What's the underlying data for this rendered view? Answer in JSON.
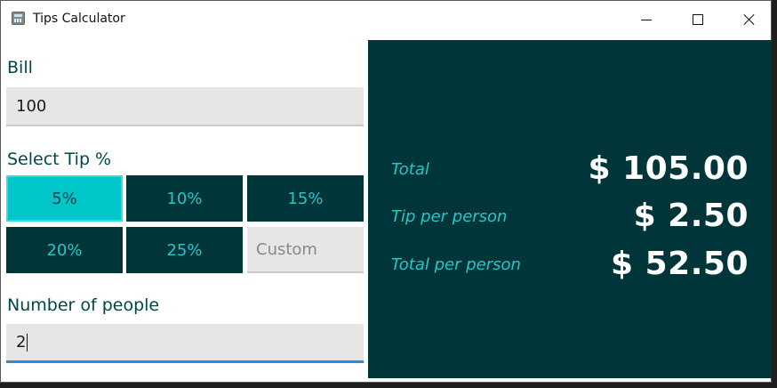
{
  "window": {
    "title": "Tips Calculator",
    "controls": [
      "minimize",
      "maximize",
      "close"
    ]
  },
  "bill": {
    "label": "Bill",
    "value": "100"
  },
  "tip": {
    "label": "Select Tip %",
    "options": [
      "5%",
      "10%",
      "15%",
      "20%",
      "25%"
    ],
    "selected": "5%",
    "custom_placeholder": "Custom"
  },
  "people": {
    "label": "Number of people",
    "value": "2"
  },
  "results": {
    "total_label": "Total",
    "total_value": "$ 105.00",
    "tip_per_person_label": "Tip per person",
    "tip_per_person_value": "$ 2.50",
    "total_per_person_label": "Total per person",
    "total_per_person_value": "$ 52.50"
  },
  "colors": {
    "accent": "#00c5c9",
    "panel": "#00363a",
    "label_text": "#00474b",
    "focus_underline": "#1f8fe0"
  }
}
